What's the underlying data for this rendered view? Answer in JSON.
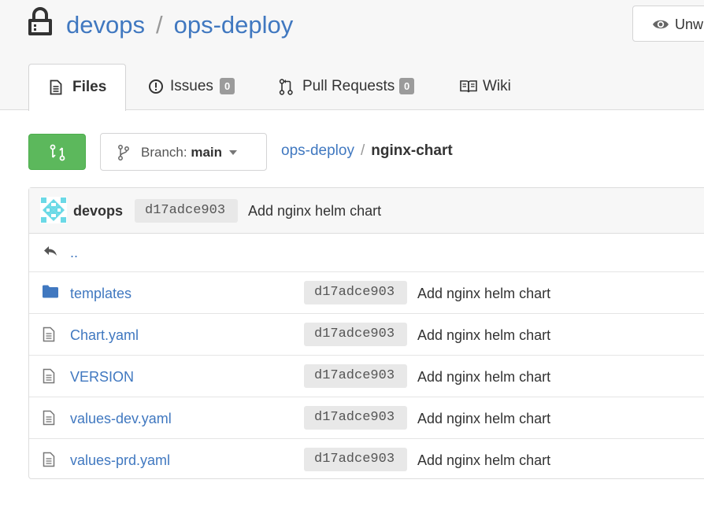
{
  "header": {
    "owner": "devops",
    "separator": "/",
    "repo": "ops-deploy",
    "watch_label": "Unw"
  },
  "tabs": [
    {
      "label": "Files",
      "icon": "file-text-icon",
      "active": true
    },
    {
      "label": "Issues",
      "icon": "issue-opened-icon",
      "count": "0"
    },
    {
      "label": "Pull Requests",
      "icon": "git-pull-request-icon",
      "count": "0"
    },
    {
      "label": "Wiki",
      "icon": "book-icon"
    }
  ],
  "toolbar": {
    "branch_prefix": "Branch:",
    "branch_name": "main",
    "breadcrumb_repo": "ops-deploy",
    "breadcrumb_sep": "/",
    "breadcrumb_current": "nginx-chart"
  },
  "latest_commit": {
    "author": "devops",
    "sha": "d17adce903",
    "message": "Add nginx helm chart"
  },
  "parent_dir": "..",
  "files": [
    {
      "name": "templates",
      "type": "directory",
      "sha": "d17adce903",
      "message": "Add nginx helm chart"
    },
    {
      "name": "Chart.yaml",
      "type": "file",
      "sha": "d17adce903",
      "message": "Add nginx helm chart"
    },
    {
      "name": "VERSION",
      "type": "file",
      "sha": "d17adce903",
      "message": "Add nginx helm chart"
    },
    {
      "name": "values-dev.yaml",
      "type": "file",
      "sha": "d17adce903",
      "message": "Add nginx helm chart"
    },
    {
      "name": "values-prd.yaml",
      "type": "file",
      "sha": "d17adce903",
      "message": "Add nginx helm chart"
    }
  ],
  "colors": {
    "link": "#4078c0",
    "pr_button": "#5cb85c",
    "badge": "#9b9b9b",
    "folder": "#4078c0"
  }
}
